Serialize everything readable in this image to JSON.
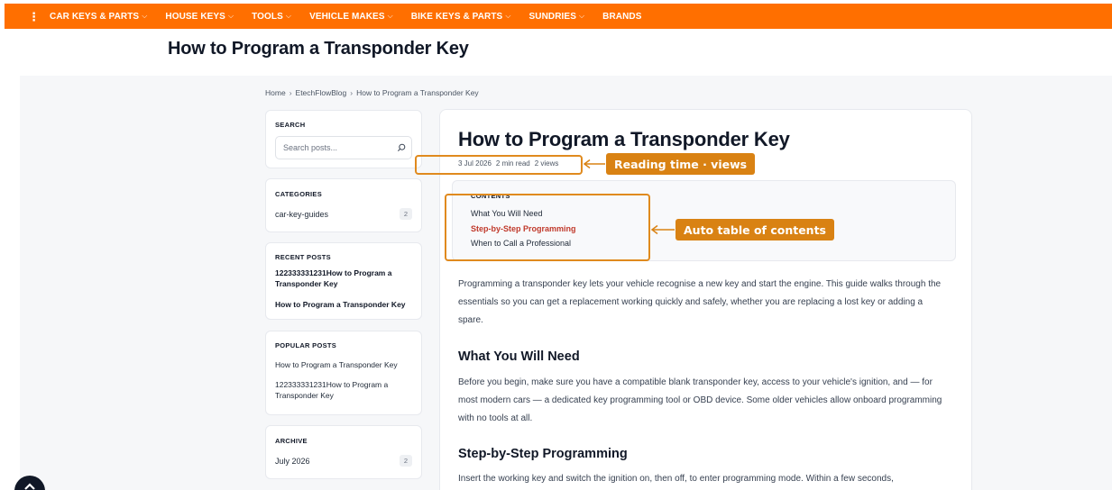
{
  "nav": {
    "items": [
      {
        "label": "CAR KEYS & PARTS",
        "has_dropdown": true
      },
      {
        "label": "HOUSE KEYS",
        "has_dropdown": true
      },
      {
        "label": "TOOLS",
        "has_dropdown": true
      },
      {
        "label": "VEHICLE MAKES",
        "has_dropdown": true
      },
      {
        "label": "BIKE KEYS & PARTS",
        "has_dropdown": true
      },
      {
        "label": "SUNDRIES",
        "has_dropdown": true
      },
      {
        "label": "BRANDS",
        "has_dropdown": false
      }
    ],
    "chevron": "⌵",
    "color": "#ff6f00"
  },
  "page_title": "How to Program a Transponder Key",
  "breadcrumb": {
    "items": [
      "Home",
      "EtechFlowBlog",
      "How to Program a Transponder Key"
    ],
    "separator": "›"
  },
  "sidebar": {
    "search": {
      "title": "SEARCH",
      "placeholder": "Search posts..."
    },
    "categories": {
      "title": "CATEGORIES",
      "items": [
        {
          "label": "car-key-guides",
          "count": "2"
        }
      ]
    },
    "recent": {
      "title": "RECENT POSTS",
      "items": [
        "122333331231How to Program a Transponder Key",
        "How to Program a Transponder Key"
      ]
    },
    "popular": {
      "title": "POPULAR POSTS",
      "items": [
        "How to Program a Transponder Key",
        "122333331231How to Program a Transponder Key"
      ]
    },
    "archive": {
      "title": "ARCHIVE",
      "items": [
        {
          "label": "July 2026",
          "count": "2"
        }
      ]
    }
  },
  "article": {
    "title": "How to Program a Transponder Key",
    "meta": {
      "date": "3 Jul 2026",
      "read_time": "2 min read",
      "views": "2 views"
    },
    "toc": {
      "title": "CONTENTS",
      "items": [
        {
          "label": "What You Will Need",
          "active": false
        },
        {
          "label": "Step-by-Step Programming",
          "active": true
        },
        {
          "label": "When to Call a Professional",
          "active": false
        }
      ]
    },
    "intro": "Programming a transponder key lets your vehicle recognise a new key and start the engine. This guide walks through the essentials so you can get a replacement working quickly and safely, whether you are replacing a lost key or adding a spare.",
    "section1": {
      "heading": "What You Will Need",
      "body": "Before you begin, make sure you have a compatible blank transponder key, access to your vehicle's ignition, and — for most modern cars — a dedicated key programming tool or OBD device. Some older vehicles allow onboard programming with no tools at all."
    },
    "section2": {
      "heading": "Step-by-Step Programming",
      "body": "Insert the working key and switch the ignition on, then off, to enter programming mode. Within a few seconds,"
    }
  },
  "annotations": {
    "meta_callout": "Reading time · views",
    "toc_callout": "Auto table of contents",
    "color": "#d98213"
  }
}
